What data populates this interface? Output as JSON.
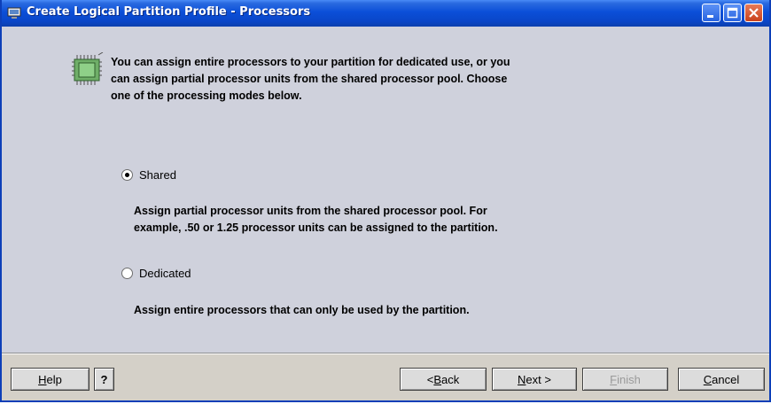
{
  "window": {
    "title": "Create Logical Partition Profile - Processors"
  },
  "intro": {
    "line1": "You can assign entire processors to your partition for dedicated use, or you",
    "line2": "can assign partial processor units from the shared processor pool. Choose",
    "line3": "one of the processing modes below."
  },
  "modes": {
    "shared": {
      "label": "Shared",
      "selected": true,
      "desc_line1": "Assign partial processor units from the shared processor pool.  For",
      "desc_line2": "example, .50 or 1.25 processor units can be assigned to the partition."
    },
    "dedicated": {
      "label": "Dedicated",
      "selected": false,
      "desc_line1": "Assign entire processors that can only be used by the partition."
    }
  },
  "buttons": {
    "help": {
      "prefix": "",
      "mnemonic": "H",
      "rest": "elp"
    },
    "help_q": "?",
    "back": {
      "prefix": "< ",
      "mnemonic": "B",
      "rest": "ack"
    },
    "next": {
      "prefix": "",
      "mnemonic": "N",
      "rest": "ext >"
    },
    "finish": {
      "prefix": "",
      "mnemonic": "F",
      "rest": "inish"
    },
    "cancel": {
      "prefix": "",
      "mnemonic": "C",
      "rest": "ancel"
    }
  },
  "icons": [
    "monitor-icon",
    "minimize-icon",
    "maximize-icon",
    "close-icon",
    "processor-chip-icon"
  ],
  "colors": {
    "titlebar": "#0b4fd8",
    "content_bg": "#cfd1dc",
    "footer_bg": "#d4d0c8",
    "close_button": "#c9421c"
  }
}
